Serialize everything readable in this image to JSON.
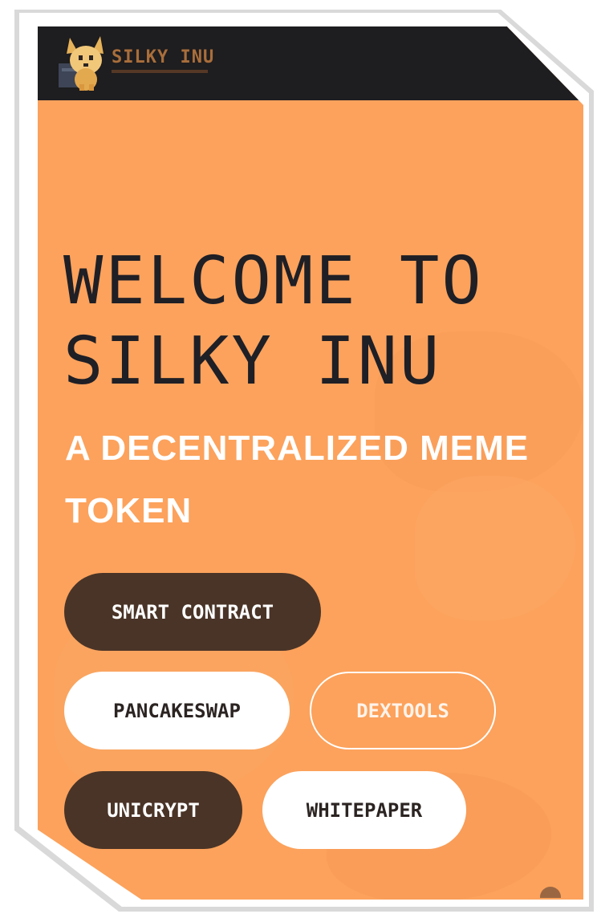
{
  "header": {
    "brand_name": "SILKY INU",
    "logo_icon": "dog-mascot-icon"
  },
  "hero": {
    "title_line1": "WELCOME TO",
    "title_line2": "SILKY INU",
    "subtitle_line1": "A DECENTRALIZED MEME",
    "subtitle_line2": "TOKEN"
  },
  "buttons": {
    "smart_contract": "SMART CONTRACT",
    "pancakeswap": "PANCAKESWAP",
    "dextools": "DEXTOOLS",
    "unicrypt": "UNICRYPT",
    "whitepaper": "WHITEPAPER"
  },
  "colors": {
    "background": "#fca25c",
    "header": "#1e1d1f",
    "dark_button": "#4a3427",
    "light_button": "#ffffff",
    "title_text": "#1f1f26"
  }
}
